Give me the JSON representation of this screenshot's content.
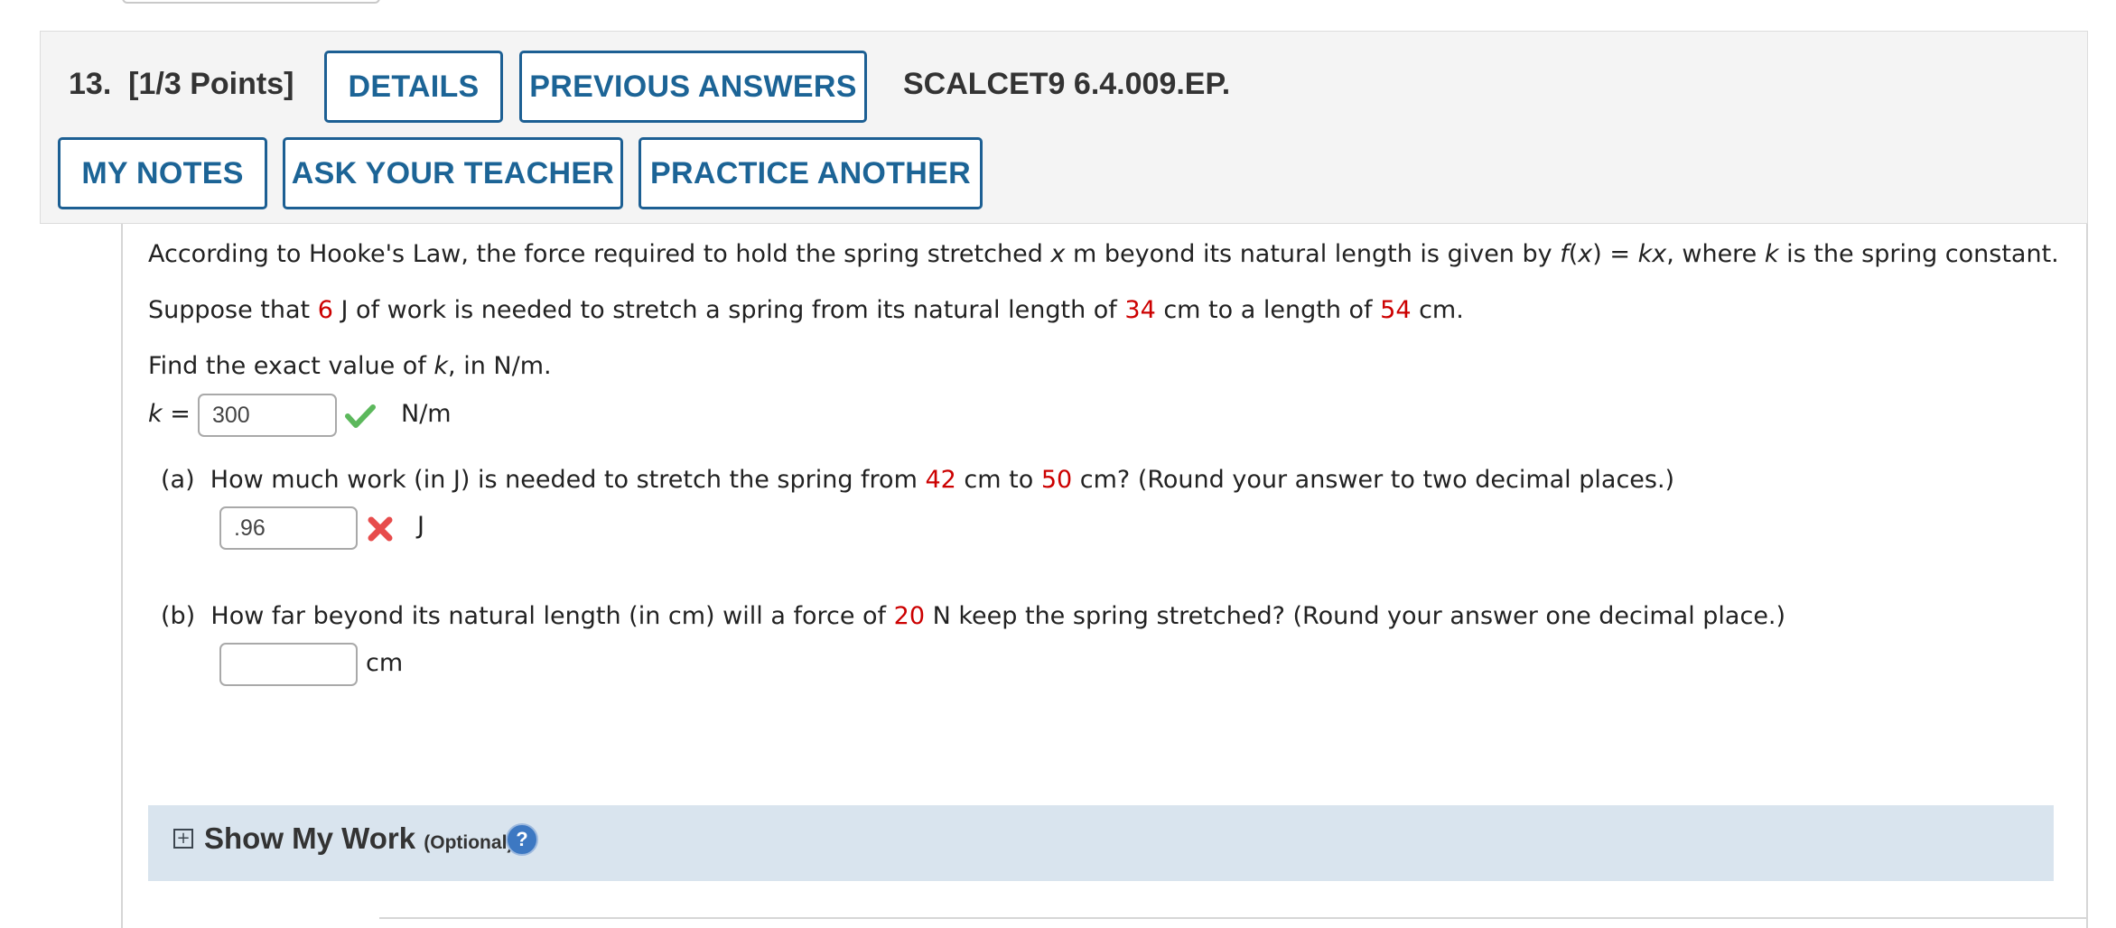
{
  "question": {
    "number": "13.",
    "points": "[1/3 Points]",
    "code": "SCALCET9 6.4.009.EP."
  },
  "buttons": {
    "details": "DETAILS",
    "previous_answers": "PREVIOUS ANSWERS",
    "my_notes": "MY NOTES",
    "ask_teacher": "ASK YOUR TEACHER",
    "practice_another": "PRACTICE ANOTHER"
  },
  "body": {
    "p1_a": "According to Hooke's Law, the force required to hold the spring stretched ",
    "p1_x": "x",
    "p1_b": " m beyond its natural length is given by ",
    "p1_f": "f",
    "p1_c": "(",
    "p1_x2": "x",
    "p1_d": ") = ",
    "p1_kx": "kx",
    "p1_e": ", where ",
    "p1_k": "k",
    "p1_f2": " is the spring constant.",
    "p2_a": "Suppose that ",
    "p2_work": "6",
    "p2_b": " J of work is needed to stretch a spring from its natural length of ",
    "p2_len1": "34",
    "p2_c": " cm to a length of ",
    "p2_len2": "54",
    "p2_d": " cm.",
    "p3_a": "Find the exact value of ",
    "p3_k": "k",
    "p3_b": ", in N/m.",
    "k_label": "k",
    "k_eq": " =",
    "k_value": "300",
    "k_unit": "N/m",
    "k_status": "correct"
  },
  "part_a": {
    "label": "(a)",
    "text_a": "How much work (in J) is needed to stretch the spring from ",
    "from": "42",
    "text_b": " cm to ",
    "to": "50",
    "text_c": " cm? (Round your answer to two decimal places.)",
    "value": ".96",
    "unit": "J",
    "status": "incorrect"
  },
  "part_b": {
    "label": "(b)",
    "text_a": "How far beyond its natural length (in cm) will a force of ",
    "force": "20",
    "text_b": " N keep the spring stretched? (Round your answer one decimal place.)",
    "value": "",
    "unit": "cm"
  },
  "show_work": {
    "title": "Show My Work",
    "optional": "(Optional)",
    "help": "?"
  },
  "colors": {
    "button_text": "#1c6496",
    "button_border": "#1c5f93",
    "highlight_red": "#cc0000",
    "check_green": "#5cb85c",
    "x_red": "#e74c4c",
    "show_work_bg": "#d9e4ee"
  }
}
